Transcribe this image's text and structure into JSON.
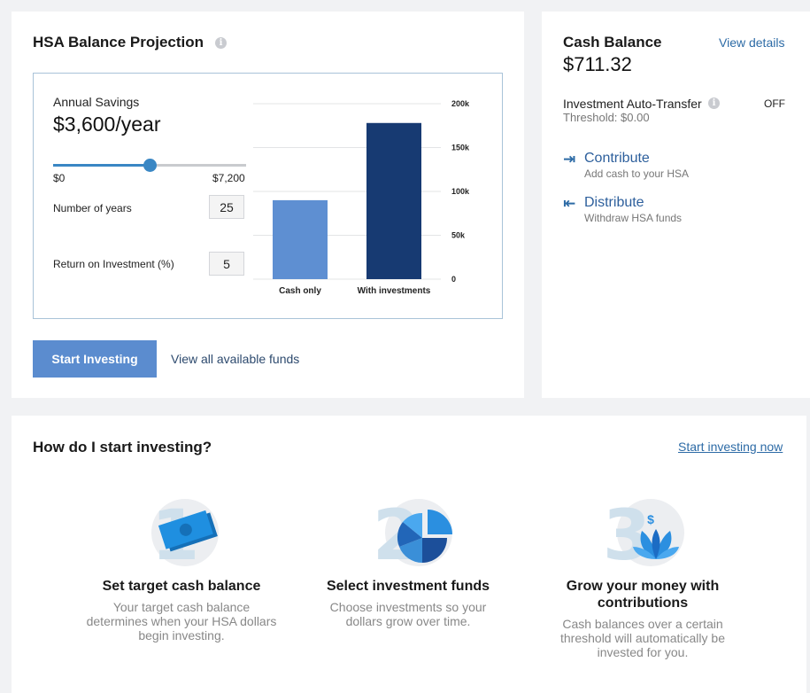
{
  "projection": {
    "title": "HSA Balance Projection",
    "annual_savings_label": "Annual Savings",
    "annual_savings_value": "$3,600/year",
    "slider": {
      "min_label": "$0",
      "max_label": "$7,200",
      "min": 0,
      "max": 7200,
      "value": 3600
    },
    "years_label": "Number of years",
    "years_value": "25",
    "roi_label": "Return on Investment (%)",
    "roi_value": "5",
    "start_button": "Start Investing",
    "funds_link": "View all available funds"
  },
  "chart_data": {
    "type": "bar",
    "categories": [
      "Cash only",
      "With investments"
    ],
    "values": [
      90000,
      178000
    ],
    "ylim": [
      0,
      200000
    ],
    "yticks": [
      0,
      50000,
      100000,
      150000,
      200000
    ],
    "ytick_labels": [
      "0",
      "50k",
      "100k",
      "150k",
      "200k"
    ],
    "colors": [
      "#5e8fd2",
      "#173a72"
    ],
    "grid": true
  },
  "cash": {
    "title": "Cash Balance",
    "amount": "$711.32",
    "view_details": "View details",
    "auto_transfer_label": "Investment Auto-Transfer",
    "auto_transfer_status": "OFF",
    "threshold": "Threshold: $0.00",
    "contribute_title": "Contribute",
    "contribute_sub": "Add cash to your HSA",
    "distribute_title": "Distribute",
    "distribute_sub": "Withdraw HSA funds"
  },
  "howto": {
    "title": "How do I start investing?",
    "start_now": "Start investing now",
    "steps": [
      {
        "number": "1",
        "title": "Set target cash balance",
        "desc": "Your target cash balance determines when your HSA dollars begin investing."
      },
      {
        "number": "2",
        "title": "Select investment funds",
        "desc": "Choose investments so your dollars grow over time."
      },
      {
        "number": "3",
        "title": "Grow your money with contributions",
        "desc": "Cash balances over a certain threshold will automatically be invested for you."
      }
    ]
  },
  "icons": {
    "info": "info-icon",
    "contribute": "arrow-right-to-bar-icon",
    "distribute": "arrow-left-from-bar-icon"
  },
  "colors": {
    "accent": "#3a87c4",
    "button": "#5b8ccf",
    "link": "#2d6ba6"
  }
}
